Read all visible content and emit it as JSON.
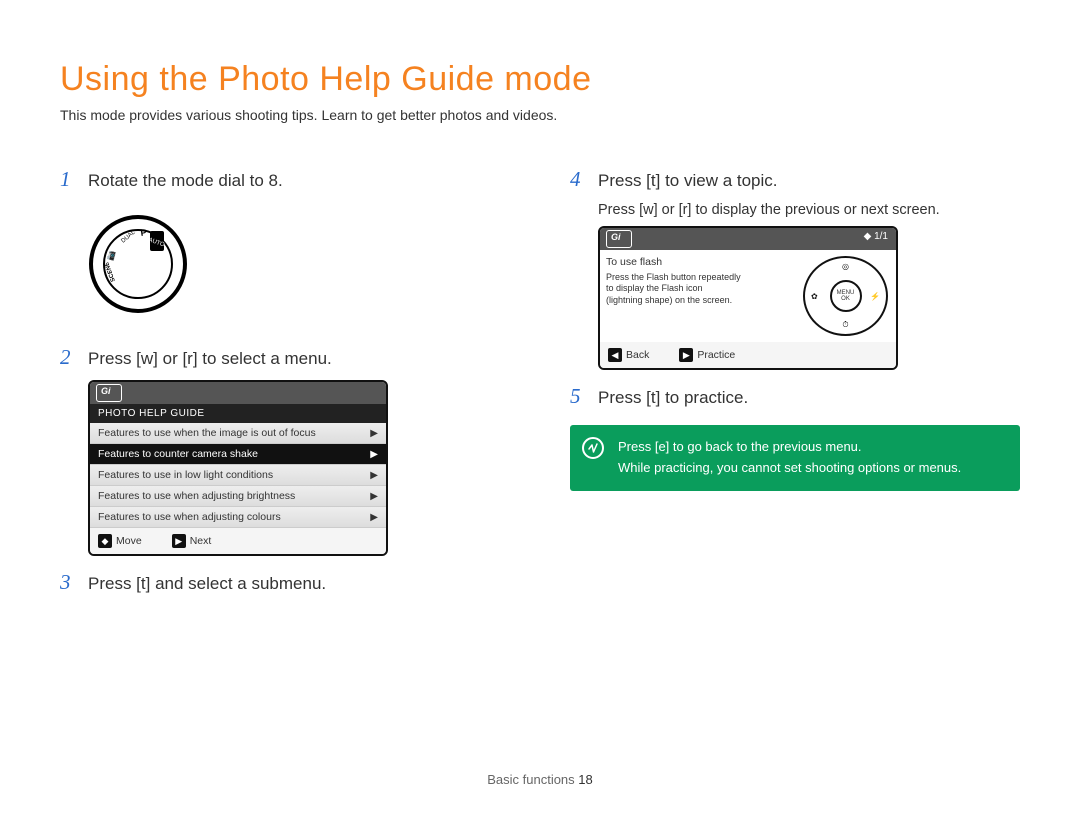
{
  "title": "Using the Photo Help Guide mode",
  "subtitle": "This mode provides various shooting tips. Learn to get better photos and videos.",
  "steps": {
    "s1": {
      "num": "1",
      "text": "Rotate the mode dial to 8."
    },
    "s2": {
      "num": "2",
      "text": "Press [w] or [r] to select a menu."
    },
    "s3": {
      "num": "3",
      "text": "Press [t] and select a submenu."
    },
    "s4": {
      "num": "4",
      "text": "Press [t] to view a topic."
    },
    "s4_sub": "Press [w] or [r] to display the previous or next screen.",
    "s5": {
      "num": "5",
      "text": "Press [t] to practice."
    }
  },
  "screen1": {
    "title": "PHOTO HELP GUIDE",
    "items": [
      "Features to use when the image is out of focus",
      "Features to counter camera shake",
      "Features to use in low light conditions",
      "Features to use when adjusting brightness",
      "Features to use when adjusting colours"
    ],
    "selected_index": 1,
    "footer": {
      "move": "Move",
      "next": "Next"
    }
  },
  "screen2": {
    "page": "1/1",
    "topic_title": "To use flash",
    "topic_lines": [
      "Press the Flash button repeatedly",
      "to display the Flash icon",
      "(lightning shape) on the screen."
    ],
    "wheel_center": [
      "MENU",
      "OK"
    ],
    "footer": {
      "back": "Back",
      "practice": "Practice"
    }
  },
  "note": {
    "line1": "Press [e] to go back to the previous menu.",
    "line2": "While practicing, you cannot set shooting options or menus."
  },
  "footer": {
    "section": "Basic functions",
    "page": "18"
  }
}
